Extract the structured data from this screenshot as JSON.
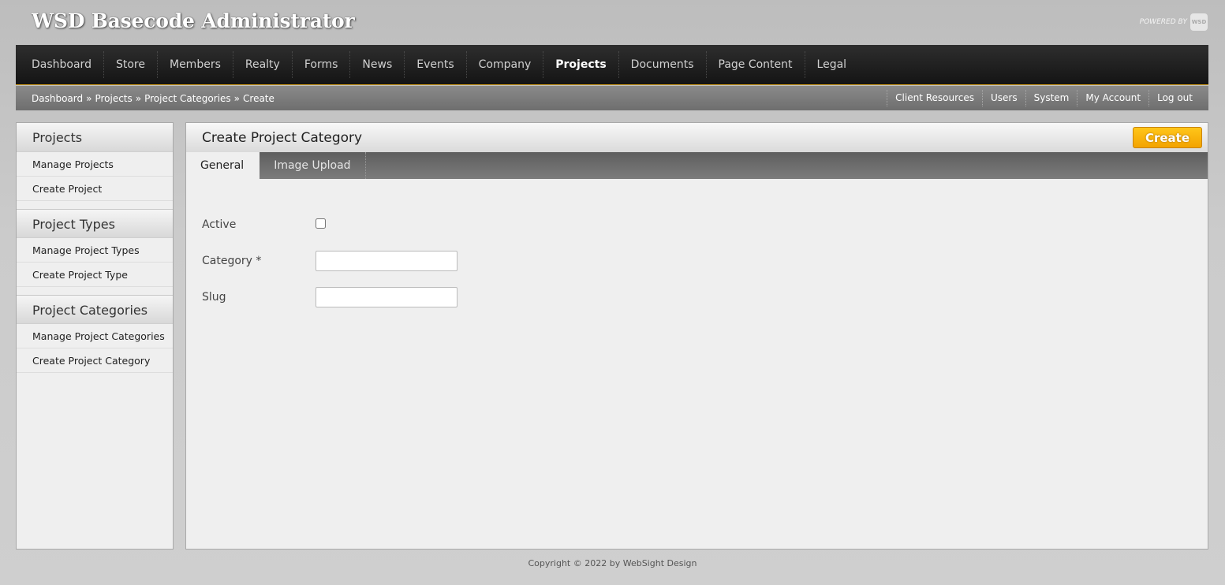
{
  "header": {
    "app_title": "WSD Basecode Administrator",
    "powered_by": "POWERED BY",
    "logo_text": "WSD"
  },
  "main_nav": {
    "items": [
      {
        "label": "Dashboard"
      },
      {
        "label": "Store"
      },
      {
        "label": "Members"
      },
      {
        "label": "Realty"
      },
      {
        "label": "Forms"
      },
      {
        "label": "News"
      },
      {
        "label": "Events"
      },
      {
        "label": "Company"
      },
      {
        "label": "Projects",
        "active": true
      },
      {
        "label": "Documents"
      },
      {
        "label": "Page Content"
      },
      {
        "label": "Legal"
      }
    ]
  },
  "breadcrumb": {
    "items": [
      "Dashboard",
      "Projects",
      "Project Categories",
      "Create"
    ],
    "separator": "»"
  },
  "util_nav": {
    "items": [
      "Client Resources",
      "Users",
      "System",
      "My Account",
      "Log out"
    ]
  },
  "sidebar": {
    "sections": [
      {
        "title": "Projects",
        "items": [
          "Manage Projects",
          "Create Project"
        ]
      },
      {
        "title": "Project Types",
        "items": [
          "Manage Project Types",
          "Create Project Type"
        ]
      },
      {
        "title": "Project Categories",
        "items": [
          "Manage Project Categories",
          "Create Project Category"
        ]
      }
    ]
  },
  "panel": {
    "title": "Create Project Category",
    "create_label": "Create",
    "tabs": [
      {
        "label": "General",
        "active": true
      },
      {
        "label": "Image Upload"
      }
    ],
    "form": {
      "active_label": "Active",
      "active_checked": false,
      "category_label": "Category *",
      "category_value": "",
      "slug_label": "Slug",
      "slug_value": ""
    }
  },
  "footer": {
    "copyright": "Copyright © 2022 by WebSight Design"
  },
  "colors": {
    "accent": "#f3a300",
    "nav_bg": "#1a1a1a",
    "nav_border": "#d9a21b"
  }
}
